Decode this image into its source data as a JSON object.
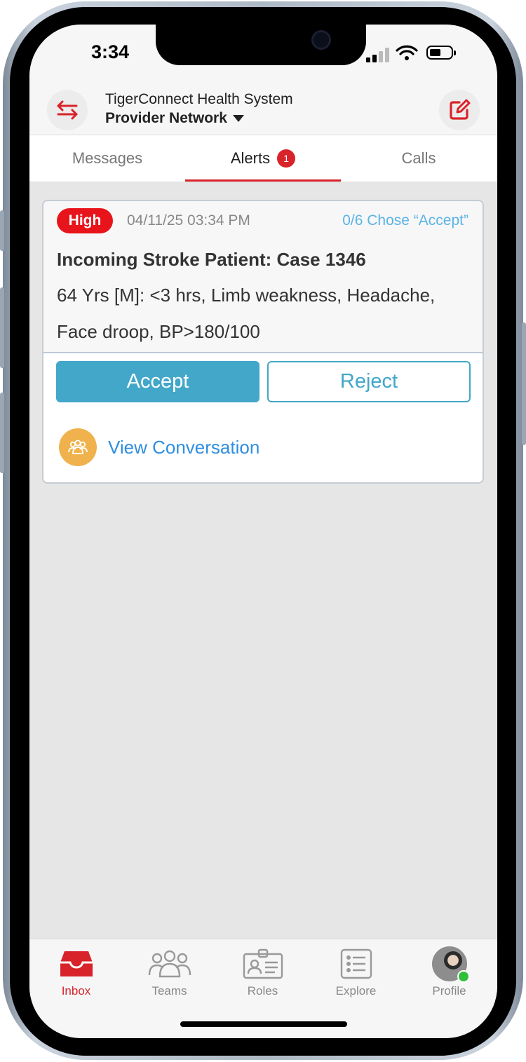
{
  "status_bar": {
    "time": "3:34"
  },
  "header": {
    "org_name": "TigerConnect Health System",
    "network_name": "Provider Network",
    "switch_icon": "swap-arrows-icon",
    "compose_icon": "compose-icon"
  },
  "tabs": [
    {
      "label": "Messages",
      "active": false
    },
    {
      "label": "Alerts",
      "active": true,
      "badge": "1"
    },
    {
      "label": "Calls",
      "active": false
    }
  ],
  "alert": {
    "priority": "High",
    "timestamp": "04/11/25 03:34 PM",
    "response_status": "0/6 Chose “Accept”",
    "title": "Incoming Stroke Patient: Case 1346",
    "body": "64 Yrs [M]: <3 hrs, Limb weakness, Headache, Face droop, BP>180/100",
    "accept_label": "Accept",
    "reject_label": "Reject",
    "view_conversation_label": "View Conversation"
  },
  "bottom_nav": [
    {
      "label": "Inbox",
      "icon": "inbox-icon",
      "active": true
    },
    {
      "label": "Teams",
      "icon": "teams-icon",
      "active": false
    },
    {
      "label": "Roles",
      "icon": "roles-icon",
      "active": false
    },
    {
      "label": "Explore",
      "icon": "explore-icon",
      "active": false
    },
    {
      "label": "Profile",
      "icon": "avatar",
      "active": false
    }
  ],
  "colors": {
    "brand_red": "#d8232a",
    "accept_blue": "#42a7c9",
    "link_blue": "#2f8ee0",
    "priority_high": "#e8141b"
  }
}
